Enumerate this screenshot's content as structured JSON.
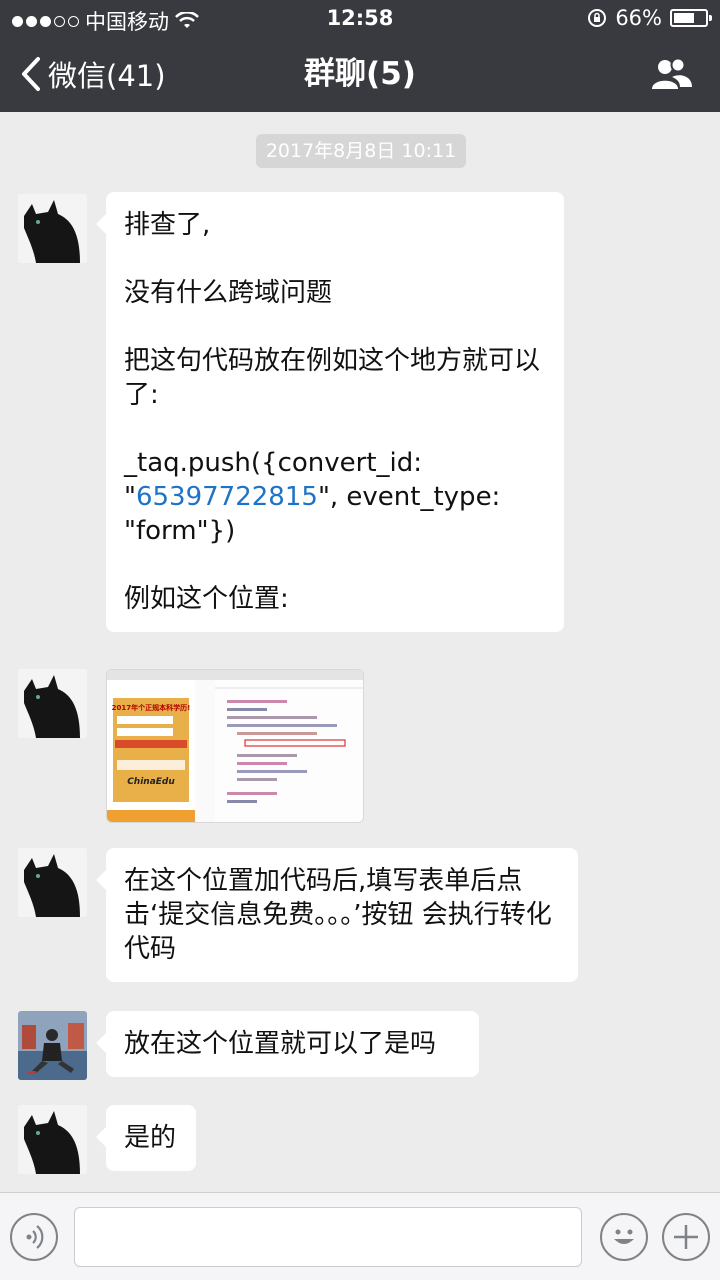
{
  "status_bar": {
    "carrier": "中国移动",
    "time": "12:58",
    "battery_percent": "66%",
    "battery_level": 0.66
  },
  "nav": {
    "back_label": "微信(41)",
    "title": "群聊(5)",
    "right_icon": "group-members-icon"
  },
  "chat": {
    "timestamp": "2017年8月8日 10:11",
    "messages": [
      {
        "sender": "cat-avatar",
        "paragraphs": [
          "排查了,",
          "没有什么跨域问题",
          "把这句代码放在例如这个地方就可以了:",
          "例如这个位置:"
        ],
        "code_prefix": "_taq.push({convert_id: \"",
        "code_link": "65397722815",
        "code_suffix": "\", event_type: \"form\"})"
      },
      {
        "sender": "cat-avatar",
        "type": "image",
        "image_texts": [
          "2017年个正规本科学历!",
          "ChinaEdu"
        ]
      },
      {
        "sender": "cat-avatar",
        "text": "在这个位置加代码后,填写表单后点击‘提交信息免费。。。’按钮 会执行转化代码"
      },
      {
        "sender": "photo-avatar",
        "text": "放在这个位置就可以了是吗"
      },
      {
        "sender": "cat-avatar",
        "text": "是的"
      }
    ]
  },
  "input_bar": {
    "voice_icon": "voice-icon",
    "emoji_icon": "emoji-icon",
    "plus_icon": "plus-icon",
    "text_value": ""
  }
}
